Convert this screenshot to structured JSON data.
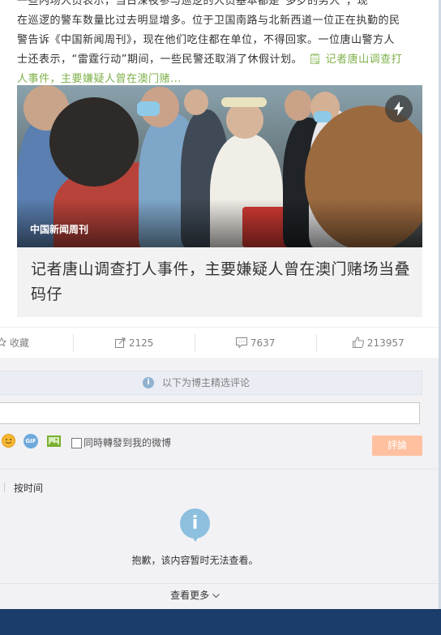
{
  "post": {
    "text_lines": [
      "一些内场人员表示，当日深夜参与巡逻的人员基本都是“多岁的男人”，现",
      "在巡逻的警车数量比过去明显增多。位于卫国南路与北新西道一位正在执勤的民",
      "警告诉《中国新闻周刊》，现在他们吃住都在单位，不得回家。一位唐山警方人",
      "士还表示，“雷霆行动”期间，一些民警还取消了休假计划。"
    ],
    "link_text": "🗒 记者唐山调查打",
    "link_text_2": "人事件，主要嫌疑人曾在澳门赌..."
  },
  "media": {
    "source_label": "中国新闻周刊",
    "badge_icon": "lightning-icon",
    "headline": "记者唐山调查打人事件，主要嫌疑人曾在澳门赌场当叠码仔"
  },
  "actions": {
    "favorite_label": "收藏",
    "repost_count": "2125",
    "comment_count": "7637",
    "like_count": "213957"
  },
  "comments": {
    "curated_notice": "以下为博主精选评论",
    "input_placeholder": "",
    "also_repost_label": "同時轉發到我的微博",
    "submit_label": "評論",
    "sort_label": "按时间",
    "unavailable_notice": "抱歉，该内容暂时无法查看。",
    "see_more_label": "查看更多"
  },
  "colors": {
    "link_green": "#7fb04a",
    "submit_bg": "#ffc09f",
    "info_blue": "#8dbfde"
  }
}
